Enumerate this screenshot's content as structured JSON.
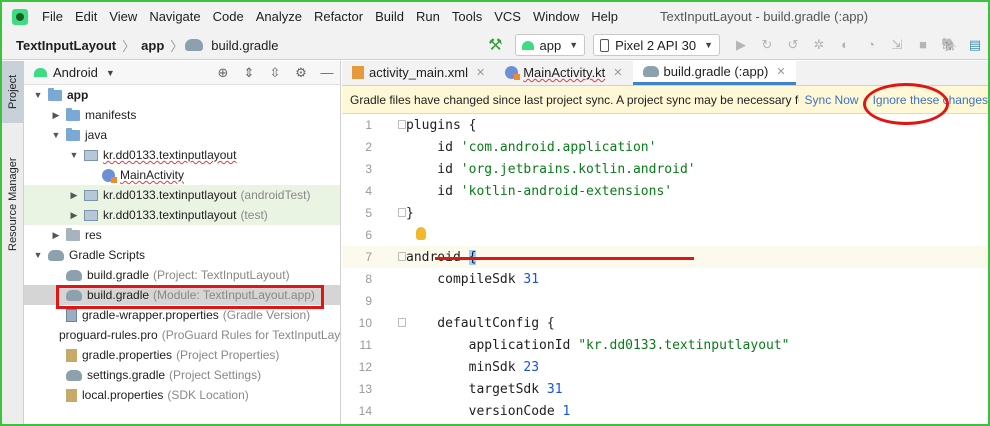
{
  "menubar": {
    "items": [
      "File",
      "Edit",
      "View",
      "Navigate",
      "Code",
      "Analyze",
      "Refactor",
      "Build",
      "Run",
      "Tools",
      "VCS",
      "Window",
      "Help"
    ],
    "title": "TextInputLayout - build.gradle (:app)"
  },
  "navbar": {
    "crumbs": [
      "TextInputLayout",
      "app",
      "build.gradle"
    ],
    "module_combo": "app",
    "device_combo": "Pixel 2 API 30"
  },
  "left_stripe": {
    "project_tab": "Project",
    "resource_tab": "Resource Manager"
  },
  "project_panel": {
    "view_selector": "Android",
    "tree": [
      {
        "label": "app",
        "indent": 0,
        "arrow": "down",
        "icon": "folder",
        "bold": true
      },
      {
        "label": "manifests",
        "indent": 1,
        "arrow": "right",
        "icon": "folder"
      },
      {
        "label": "java",
        "indent": 1,
        "arrow": "down",
        "icon": "folder"
      },
      {
        "label": "kr.dd0133.textinputlayout",
        "indent": 2,
        "arrow": "down",
        "icon": "package",
        "wavy": true
      },
      {
        "label": "MainActivity",
        "indent": 3,
        "arrow": "",
        "icon": "kotlin",
        "wavy": true
      },
      {
        "label": "kr.dd0133.textinputlayout",
        "hint": "(androidTest)",
        "indent": 2,
        "arrow": "right",
        "icon": "package",
        "highlight": true
      },
      {
        "label": "kr.dd0133.textinputlayout",
        "hint": "(test)",
        "indent": 2,
        "arrow": "right",
        "icon": "package",
        "highlight": true
      },
      {
        "label": "res",
        "indent": 1,
        "arrow": "right",
        "icon": "folder-gray"
      },
      {
        "label": "Gradle Scripts",
        "indent": 0,
        "arrow": "down",
        "icon": "gradle"
      },
      {
        "label": "build.gradle",
        "hint": "(Project: TextInputLayout)",
        "indent": 1,
        "arrow": "",
        "icon": "gradle"
      },
      {
        "label": "build.gradle",
        "hint": "(Module: TextInputLayout.app)",
        "indent": 1,
        "arrow": "",
        "icon": "gradle",
        "selected": true
      },
      {
        "label": "gradle-wrapper.properties",
        "hint": "(Gradle Version)",
        "indent": 1,
        "arrow": "",
        "icon": "doc"
      },
      {
        "label": "proguard-rules.pro",
        "hint": "(ProGuard Rules for TextInputLayout.app)",
        "indent": 1,
        "arrow": "",
        "icon": "pro"
      },
      {
        "label": "gradle.properties",
        "hint": "(Project Properties)",
        "indent": 1,
        "arrow": "",
        "icon": "gprop"
      },
      {
        "label": "settings.gradle",
        "hint": "(Project Settings)",
        "indent": 1,
        "arrow": "",
        "icon": "gradle"
      },
      {
        "label": "local.properties",
        "hint": "(SDK Location)",
        "indent": 1,
        "arrow": "",
        "icon": "gprop"
      }
    ]
  },
  "editor": {
    "tabs": [
      {
        "label": "activity_main.xml",
        "icon": "xml"
      },
      {
        "label": "MainActivity.kt",
        "icon": "kotlin",
        "wavy": true
      },
      {
        "label": "build.gradle (:app)",
        "icon": "gradle",
        "active": true
      }
    ],
    "banner": {
      "message": "Gradle files have changed since last project sync. A project sync may be necessary for the IDE to work properly.",
      "sync_now": "Sync Now",
      "ignore": "Ignore these changes"
    },
    "lines": [
      {
        "n": "1",
        "segs": [
          [
            "plain",
            "plugins {"
          ]
        ],
        "fold": true
      },
      {
        "n": "2",
        "segs": [
          [
            "plain",
            "    id "
          ],
          [
            "str",
            "'com.android.application'"
          ]
        ]
      },
      {
        "n": "3",
        "segs": [
          [
            "plain",
            "    id "
          ],
          [
            "str",
            "'org.jetbrains.kotlin.android'"
          ]
        ]
      },
      {
        "n": "4",
        "segs": [
          [
            "plain",
            "    id "
          ],
          [
            "str",
            "'kotlin-android-extensions'"
          ]
        ]
      },
      {
        "n": "5",
        "segs": [
          [
            "plain",
            "}"
          ]
        ],
        "fold": true
      },
      {
        "n": "6",
        "segs": [
          [
            "plain",
            ""
          ]
        ],
        "bulb": true
      },
      {
        "n": "7",
        "segs": [
          [
            "plain",
            "android "
          ],
          [
            "brace",
            "{"
          ]
        ],
        "fold": true,
        "current": true
      },
      {
        "n": "8",
        "segs": [
          [
            "plain",
            "    compileSdk "
          ],
          [
            "num",
            "31"
          ]
        ]
      },
      {
        "n": "9",
        "segs": [
          [
            "plain",
            ""
          ]
        ]
      },
      {
        "n": "10",
        "segs": [
          [
            "plain",
            "    defaultConfig {"
          ]
        ],
        "fold": true
      },
      {
        "n": "11",
        "segs": [
          [
            "plain",
            "        applicationId "
          ],
          [
            "strb",
            "\"kr.dd0133.textinputlayout\""
          ]
        ]
      },
      {
        "n": "12",
        "segs": [
          [
            "plain",
            "        minSdk "
          ],
          [
            "num",
            "23"
          ]
        ]
      },
      {
        "n": "13",
        "segs": [
          [
            "plain",
            "        targetSdk "
          ],
          [
            "num",
            "31"
          ]
        ]
      },
      {
        "n": "14",
        "segs": [
          [
            "plain",
            "        versionCode "
          ],
          [
            "num",
            "1"
          ]
        ]
      }
    ]
  }
}
